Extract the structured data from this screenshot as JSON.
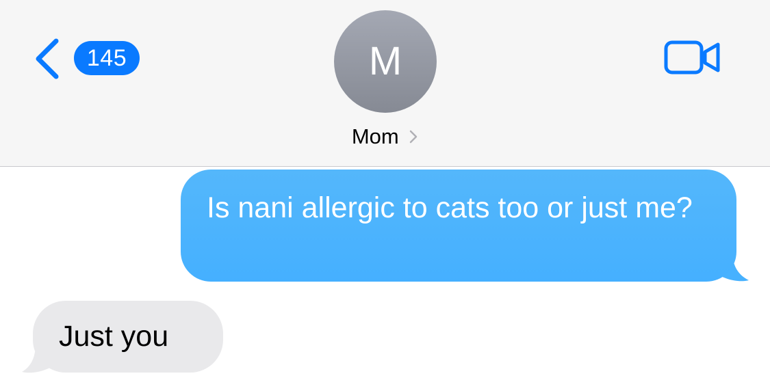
{
  "header": {
    "back_icon": "chevron-left-icon",
    "unread_count": "145",
    "contact_initial": "M",
    "contact_name": "Mom",
    "contact_chevron_icon": "chevron-right-icon",
    "video_icon": "video-camera-icon"
  },
  "messages": [
    {
      "direction": "outgoing",
      "text": "Is nani allergic to cats too or just me?"
    },
    {
      "direction": "incoming",
      "text": "Just you"
    }
  ],
  "colors": {
    "accent": "#0a7aff",
    "outgoing_bubble": "#4fb5fd",
    "incoming_bubble": "#e9e9eb",
    "header_bg": "#f6f6f6"
  }
}
